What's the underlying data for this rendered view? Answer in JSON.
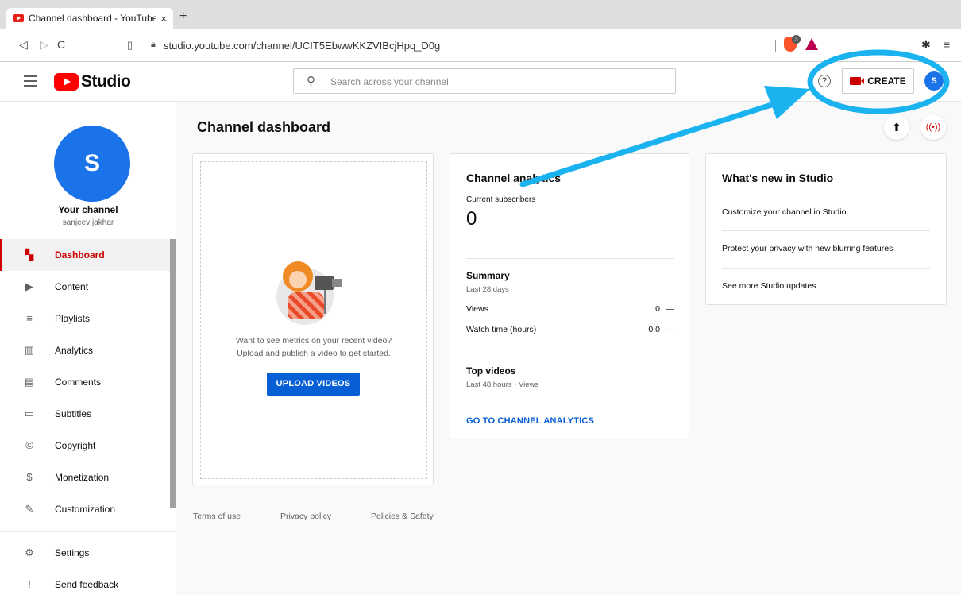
{
  "browser": {
    "tab_title": "Channel dashboard - YouTube S",
    "tab_close": "×",
    "new_tab": "+",
    "url": "studio.youtube.com/channel/UCIT5EbwwKKZVIBcjHpq_D0g",
    "back": "◁",
    "forward": "▷",
    "reload": "C",
    "brave_badge": "3"
  },
  "header": {
    "logo_text": "Studio",
    "search_placeholder": "Search across your channel",
    "create_label": "CREATE",
    "avatar_letter": "S"
  },
  "sidebar": {
    "avatar_letter": "S",
    "your_channel": "Your channel",
    "channel_name": "sanjeev jakhar",
    "items": [
      {
        "label": "Dashboard",
        "icon": "dashboard-icon",
        "active": true
      },
      {
        "label": "Content",
        "icon": "content-icon"
      },
      {
        "label": "Playlists",
        "icon": "playlists-icon"
      },
      {
        "label": "Analytics",
        "icon": "analytics-icon"
      },
      {
        "label": "Comments",
        "icon": "comments-icon"
      },
      {
        "label": "Subtitles",
        "icon": "subtitles-icon"
      },
      {
        "label": "Copyright",
        "icon": "copyright-icon"
      },
      {
        "label": "Monetization",
        "icon": "monetization-icon"
      },
      {
        "label": "Customization",
        "icon": "customization-icon"
      }
    ],
    "bottom_items": [
      {
        "label": "Settings",
        "icon": "settings-icon"
      },
      {
        "label": "Send feedback",
        "icon": "feedback-icon"
      }
    ]
  },
  "main": {
    "title": "Channel dashboard",
    "upload_card": {
      "message_line1": "Want to see metrics on your recent video?",
      "message_line2": "Upload and publish a video to get started.",
      "button": "UPLOAD VIDEOS"
    },
    "analytics_card": {
      "title": "Channel analytics",
      "subscribers_label": "Current subscribers",
      "subscribers_value": "0",
      "summary_title": "Summary",
      "summary_period": "Last 28 days",
      "rows": [
        {
          "label": "Views",
          "value": "0",
          "trend": "—"
        },
        {
          "label": "Watch time (hours)",
          "value": "0.0",
          "trend": "—"
        }
      ],
      "top_videos_title": "Top videos",
      "top_videos_period": "Last 48 hours · Views",
      "link": "GO TO CHANNEL ANALYTICS"
    },
    "whats_new_card": {
      "title": "What's new in Studio",
      "items": [
        "Customize your channel in Studio",
        "Protect your privacy with new blurring features",
        "See more Studio updates"
      ]
    }
  },
  "footer": {
    "links": [
      "Terms of use",
      "Privacy policy",
      "Policies & Safety"
    ]
  },
  "colors": {
    "accent_red": "#cc0000",
    "brand_blue": "#065fd4",
    "annotation_cyan": "#1ab3f0"
  }
}
